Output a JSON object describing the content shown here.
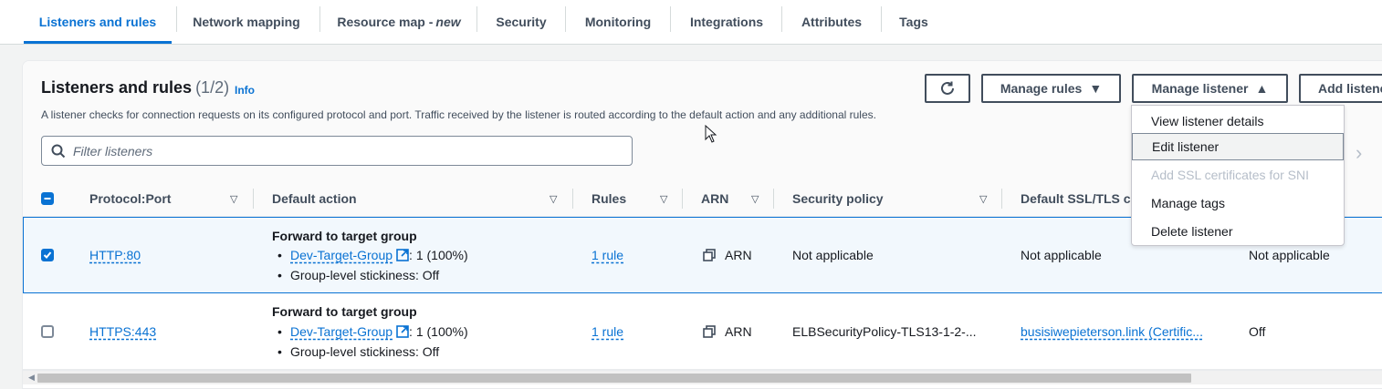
{
  "tabs": [
    {
      "label": "Listeners and rules",
      "suffix": ""
    },
    {
      "label": "Network mapping",
      "suffix": ""
    },
    {
      "label": "Resource map -",
      "suffix": "new"
    },
    {
      "label": "Security",
      "suffix": ""
    },
    {
      "label": "Monitoring",
      "suffix": ""
    },
    {
      "label": "Integrations",
      "suffix": ""
    },
    {
      "label": "Attributes",
      "suffix": ""
    },
    {
      "label": "Tags",
      "suffix": ""
    }
  ],
  "panel": {
    "title": "Listeners and rules",
    "count": "(1/2)",
    "info": "Info",
    "description": "A listener checks for connection requests on its configured protocol and port. Traffic received by the listener is routed according to the default action and any additional rules.",
    "filter_placeholder": "Filter listeners"
  },
  "buttons": {
    "manage_rules": "Manage rules",
    "manage_listener": "Manage listener",
    "add_listener": "Add listene"
  },
  "listener_menu": [
    {
      "label": "View listener details",
      "state": "normal"
    },
    {
      "label": "Edit listener",
      "state": "highlighted"
    },
    {
      "label": "Add SSL certificates for SNI",
      "state": "disabled"
    },
    {
      "label": "Manage tags",
      "state": "normal"
    },
    {
      "label": "Delete listener",
      "state": "normal"
    }
  ],
  "columns": {
    "protocol_port": "Protocol:Port",
    "default_action": "Default action",
    "rules": "Rules",
    "arn": "ARN",
    "security_policy": "Security policy",
    "default_ssl": "Default SSL/TLS c"
  },
  "rows": [
    {
      "selected": true,
      "protocol_port": "HTTP:80",
      "action_title": "Forward to target group",
      "target_group": "Dev-Target-Group",
      "target_weight": ": 1 (100%)",
      "stickiness": "Group-level stickiness: Off",
      "rules": "1 rule",
      "arn": "ARN",
      "security_policy": "Not applicable",
      "default_ssl": "Not applicable",
      "extra": "Not applicable"
    },
    {
      "selected": false,
      "protocol_port": "HTTPS:443",
      "action_title": "Forward to target group",
      "target_group": "Dev-Target-Group",
      "target_weight": ": 1 (100%)",
      "stickiness": "Group-level stickiness: Off",
      "rules": "1 rule",
      "arn": "ARN",
      "security_policy": "ELBSecurityPolicy-TLS13-1-2-...",
      "default_ssl": "busisiwepieterson.link (Certific...",
      "extra": "Off"
    }
  ],
  "colors": {
    "accent": "#0972d3",
    "text": "#16191f",
    "secondary_text": "#414d5c",
    "disabled": "#b6bec9",
    "selected_row_bg": "#f2f8fd"
  }
}
